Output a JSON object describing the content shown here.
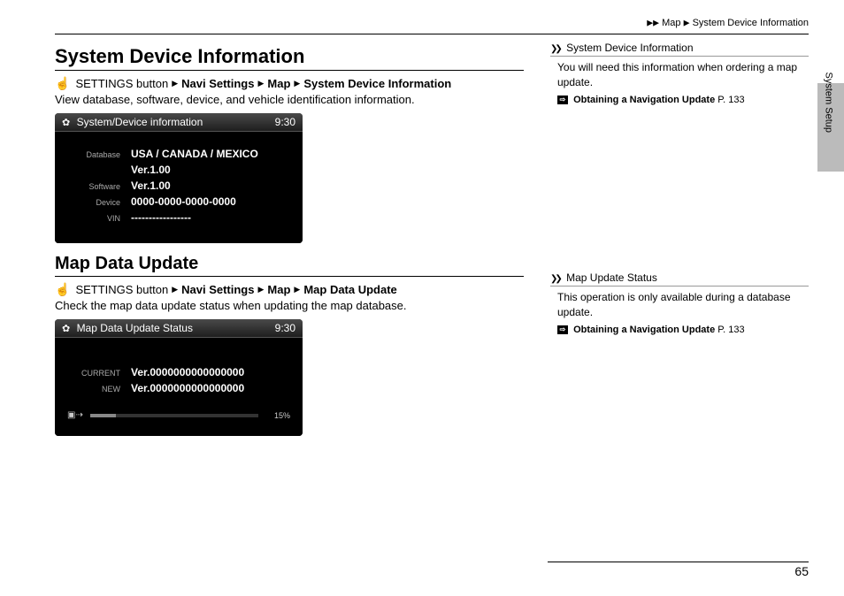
{
  "breadcrumb": {
    "sep": "▶",
    "parts": [
      "Map",
      "System Device Information"
    ]
  },
  "section1": {
    "heading": "System Device Information",
    "path": {
      "start": "SETTINGS button",
      "steps": [
        "Navi Settings",
        "Map",
        "System Device Information"
      ]
    },
    "desc": "View database, software, device, and vehicle identification information.",
    "screen": {
      "title": "System/Device information",
      "clock": "9:30",
      "rows": [
        {
          "label": "Database",
          "value": "USA / CANADA / MEXICO"
        },
        {
          "label": "",
          "value": "Ver.1.00"
        },
        {
          "label": "Software",
          "value": "Ver.1.00"
        },
        {
          "label": "Device",
          "value": "0000-0000-0000-0000"
        },
        {
          "label": "VIN",
          "value": "-----------------"
        }
      ]
    }
  },
  "section2": {
    "heading": "Map Data Update",
    "path": {
      "start": "SETTINGS button",
      "steps": [
        "Navi Settings",
        "Map",
        "Map Data Update"
      ]
    },
    "desc": "Check the map data update status when updating the map database.",
    "screen": {
      "title": "Map Data Update Status",
      "clock": "9:30",
      "rows": [
        {
          "label": "CURRENT",
          "value": "Ver.0000000000000000"
        },
        {
          "label": "NEW",
          "value": "Ver.0000000000000000"
        }
      ],
      "progress_pct": "15%"
    }
  },
  "sidebar": {
    "note1": {
      "title": "System Device Information",
      "body": "You will need this information when ordering a map update.",
      "ref": "Obtaining a Navigation Update",
      "ref_page": "P. 133"
    },
    "note2": {
      "title": "Map Update Status",
      "body": "This operation is only available during a database update.",
      "ref": "Obtaining a Navigation Update",
      "ref_page": "P. 133"
    }
  },
  "tab_label": "System Setup",
  "page_number": "65"
}
